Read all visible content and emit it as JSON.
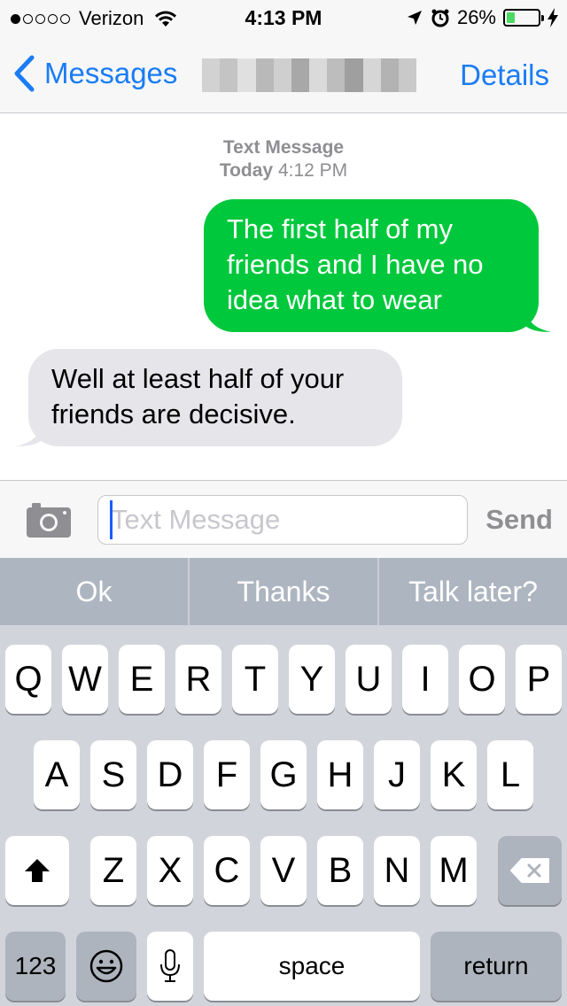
{
  "status_bar": {
    "signal_dots": [
      true,
      false,
      false,
      false,
      false
    ],
    "carrier": "Verizon",
    "time": "4:13 PM",
    "battery_percent": "26%",
    "battery_level": 0.26
  },
  "nav": {
    "back_label": "Messages",
    "details_label": "Details"
  },
  "conversation": {
    "header_type": "Text Message",
    "header_day": "Today",
    "header_time": "4:12 PM",
    "messages": [
      {
        "direction": "outgoing",
        "text": "The first half of my friends and I have no idea what to wear"
      },
      {
        "direction": "incoming",
        "text": "Well at least half of your friends are decisive."
      }
    ]
  },
  "compose": {
    "placeholder": "Text Message",
    "send_label": "Send"
  },
  "predictive": [
    "Ok",
    "Thanks",
    "Talk later?"
  ],
  "keyboard": {
    "row1": [
      "Q",
      "W",
      "E",
      "R",
      "T",
      "Y",
      "U",
      "I",
      "O",
      "P"
    ],
    "row2": [
      "A",
      "S",
      "D",
      "F",
      "G",
      "H",
      "J",
      "K",
      "L"
    ],
    "row3": [
      "Z",
      "X",
      "C",
      "V",
      "B",
      "N",
      "M"
    ],
    "numbers_label": "123",
    "space_label": "space",
    "return_label": "return"
  },
  "colors": {
    "accent": "#1a7cf5",
    "outgoing_bubble": "#00c83c",
    "incoming_bubble": "#e5e5ea",
    "battery_fill": "#4cd964"
  }
}
